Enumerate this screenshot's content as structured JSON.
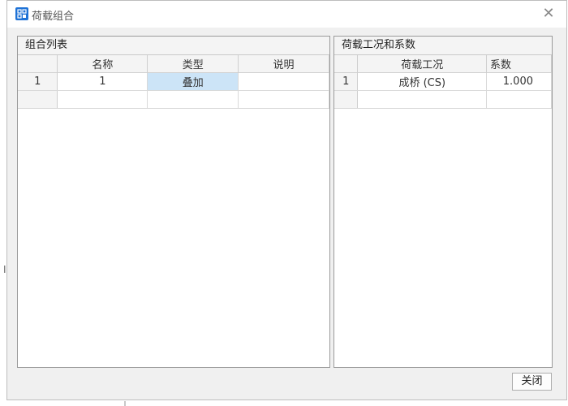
{
  "window": {
    "title": "荷载组合",
    "close_glyph": "✕",
    "icon": "app-icon"
  },
  "combo_list": {
    "title": "组合列表",
    "columns": [
      "",
      "名称",
      "类型",
      "说明"
    ],
    "rows": [
      {
        "index": "1",
        "name": "1",
        "type": "叠加",
        "note": ""
      },
      {
        "index": "",
        "name": "",
        "type": "",
        "note": ""
      }
    ]
  },
  "case_factors": {
    "title": "荷载工况和系数",
    "columns": [
      "",
      "荷载工况",
      "系数"
    ],
    "rows": [
      {
        "index": "1",
        "case": "成桥 (CS)",
        "factor": "1.000"
      },
      {
        "index": "",
        "case": "",
        "factor": ""
      }
    ]
  },
  "footer": {
    "close_label": "关闭"
  },
  "background": {
    "edge_mark": "I"
  },
  "colors": {
    "accent": "#1e72d6",
    "selection": "#cce4f7"
  }
}
